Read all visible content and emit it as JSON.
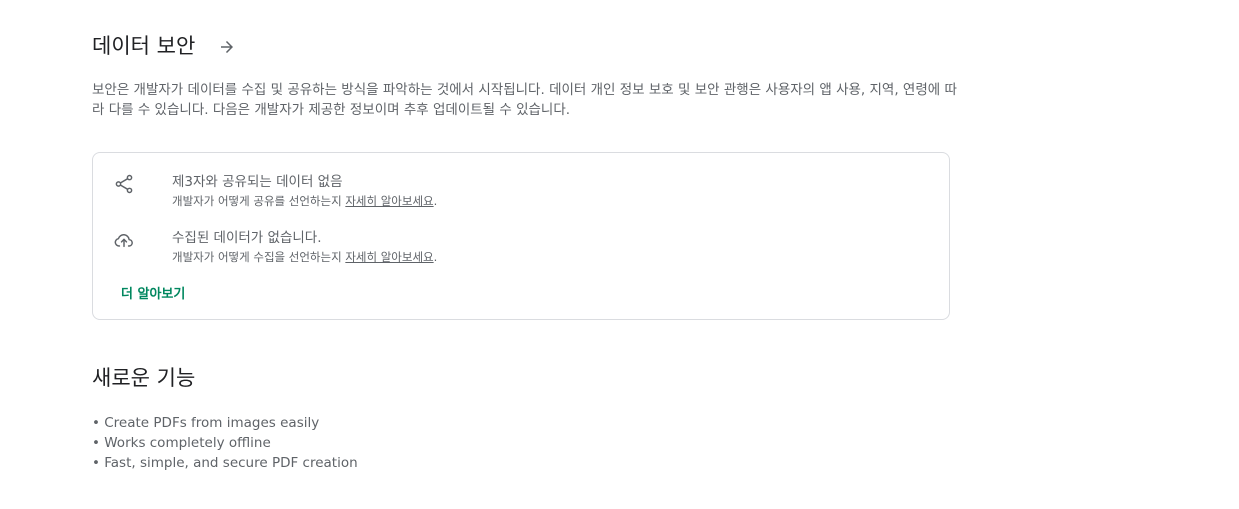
{
  "data_safety": {
    "title": "데이터 보안",
    "description": "보안은 개발자가 데이터를 수집 및 공유하는 방식을 파악하는 것에서 시작됩니다. 데이터 개인 정보 보호 및 보안 관행은 사용자의 앱 사용, 지역, 연령에 따라 다를 수 있습니다. 다음은 개발자가 제공한 정보이며 추후 업데이트될 수 있습니다.",
    "arrow_icon": "arrow-right-icon",
    "items": [
      {
        "icon": "share-icon",
        "title": "제3자와 공유되는 데이터 없음",
        "subtitle_prefix": "개발자가 어떻게 공유를 선언하는지 ",
        "link": "자세히 알아보세요",
        "suffix": "."
      },
      {
        "icon": "cloud-upload-icon",
        "title": "수집된 데이터가 없습니다.",
        "subtitle_prefix": "개발자가 어떻게 수집을 선언하는지 ",
        "link": "자세히 알아보세요",
        "suffix": "."
      }
    ],
    "learn_more": "더 알아보기",
    "accent_color": "#01875f"
  },
  "whats_new": {
    "title": "새로운 기능",
    "items": [
      "• Create PDFs from images easily",
      "• Works completely offline",
      "• Fast, simple, and secure PDF creation"
    ]
  }
}
